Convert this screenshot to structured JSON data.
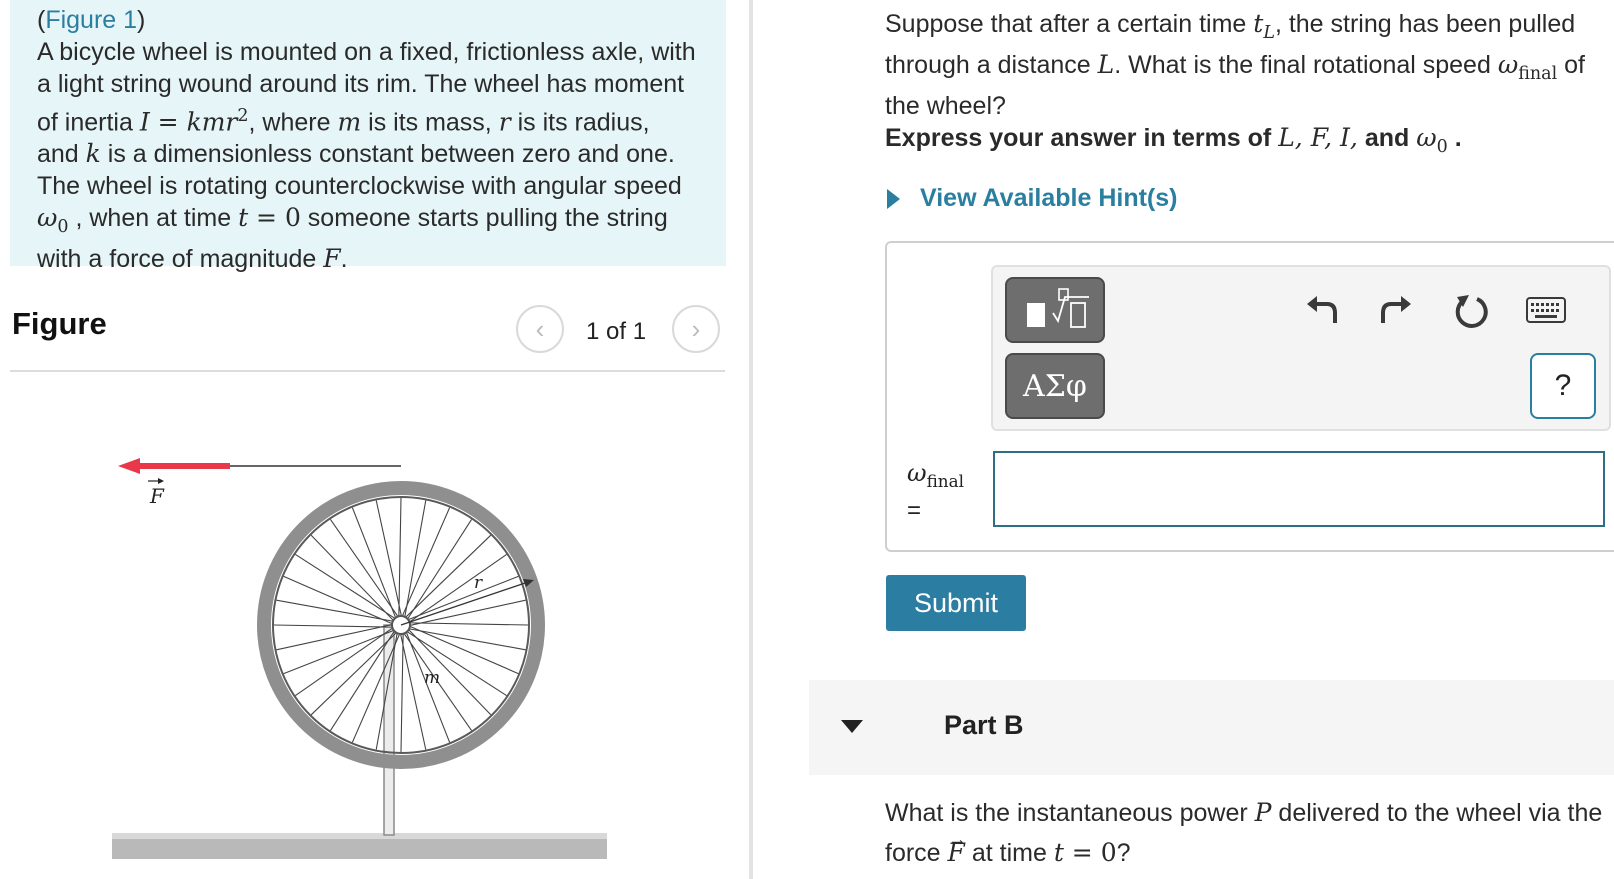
{
  "intro": {
    "figure_link": "Figure 1",
    "t1": "A bicycle wheel is mounted on a fixed, frictionless axle, with a light string wound around its rim. The wheel has moment of inertia ",
    "m_I": "I",
    "m_eq": " = ",
    "m_kmr": "kmr",
    "m_sq": "2",
    "t2": ", where ",
    "m_m": "m",
    "t3": " is its mass, ",
    "m_r": "r",
    "t4": " is its radius, and ",
    "m_k": "k",
    "t5": " is a dimensionless constant between zero and one. The wheel is rotating counterclockwise with angular speed ",
    "m_omega": "ω",
    "m_zero": "0",
    "t6": " , when at time ",
    "m_t": "t",
    "m_eq0": " = 0",
    "t7": " someone starts pulling the string with a force of magnitude ",
    "m_F": "F",
    "t8": "."
  },
  "figure": {
    "heading": "Figure",
    "pager": "1 of 1",
    "label_F": "F",
    "label_r": "r",
    "label_m": "m",
    "arrow_color": "#e8384a"
  },
  "question": {
    "t1": "Suppose that after a certain time ",
    "m_t": "t",
    "m_L_sub": "L",
    "t2": ", the string has been pulled through a distance ",
    "m_L": "L",
    "t3": ". What is the final rotational speed ",
    "m_omega": "ω",
    "m_final": "final",
    "t4": " of the wheel?"
  },
  "instruction": {
    "t1": "Express your answer in terms of ",
    "m_list": "L, F, I,",
    "t2": " and ",
    "m_omega": "ω",
    "m_zero": "0",
    "t3": " ."
  },
  "hint": {
    "label": "View Available Hint(s)"
  },
  "answer": {
    "var": "ω",
    "var_sub": "final",
    "eq": "=",
    "value": "",
    "greek_btn": "ΑΣφ",
    "help": "?"
  },
  "submit_label": "Submit",
  "part_b": {
    "label": "Part B",
    "t1": "What is the instantaneous power ",
    "m_P": "P",
    "t2": " delivered to the wheel via the force ",
    "m_F": "F",
    "t3": " at time ",
    "m_t": "t",
    "m_eq0": " = 0",
    "t4": "?"
  },
  "icons": [
    "templates-icon",
    "greek-letters-icon",
    "undo-icon",
    "redo-icon",
    "reset-icon",
    "keyboard-icon",
    "help-icon",
    "chevron-left-icon",
    "chevron-right-icon",
    "triangle-right-icon",
    "triangle-down-icon"
  ]
}
